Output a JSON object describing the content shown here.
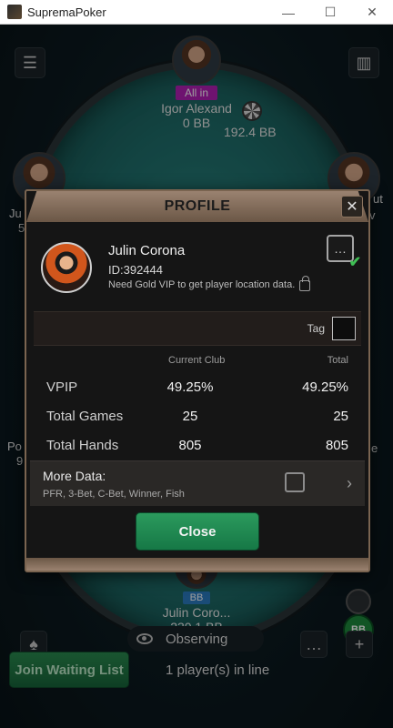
{
  "window": {
    "title": "SupremaPoker",
    "controls": [
      "—",
      "☐",
      "✕"
    ]
  },
  "table": {
    "top_player": {
      "status": "All in",
      "name": "Igor Alexand",
      "stack": "0 BB"
    },
    "pot": "192.4 BB",
    "left_players": [
      {
        "name": "Ju",
        "stack": "5"
      },
      {
        "name": "Po",
        "stack": "9"
      }
    ],
    "right_players": [
      {
        "name": "v",
        "stack": ""
      },
      {
        "name": "e",
        "stack": ""
      }
    ],
    "right_tags": [
      "ut"
    ],
    "bottom_player": {
      "position": "BB",
      "name": "Julin Coro...",
      "stack": "230.1 BB"
    },
    "bb_badge": "BB"
  },
  "observing": {
    "label": "Observing"
  },
  "join_button": {
    "label": "Join Waiting List"
  },
  "waiting_line": {
    "text": "1 player(s) in line"
  },
  "profile_modal": {
    "title": "PROFILE",
    "name": "Julin Corona",
    "id": "ID:392444",
    "note": "Need Gold VIP to get player location data.",
    "tag_label": "Tag",
    "columns": {
      "club": "Current Club",
      "total": "Total"
    },
    "rows": [
      {
        "label": "VPIP",
        "club": "49.25%",
        "total": "49.25%"
      },
      {
        "label": "Total Games",
        "club": "25",
        "total": "25"
      },
      {
        "label": "Total Hands",
        "club": "805",
        "total": "805"
      }
    ],
    "more_data": {
      "title": "More Data:",
      "items": "PFR, 3-Bet, C-Bet, Winner, Fish"
    },
    "close_label": "Close"
  },
  "colors": {
    "felt": "#1f6e6b",
    "allin": "#b21fb5",
    "bb": "#2a7bc0",
    "join_green": "#2a8a4f",
    "modal_border": "#7a6450"
  },
  "icons": [
    "menu-icon",
    "stats-icon",
    "spade-icon",
    "chat-icon",
    "plus-icon",
    "eye-icon",
    "close-icon",
    "lock-icon",
    "chevron-right-icon"
  ]
}
